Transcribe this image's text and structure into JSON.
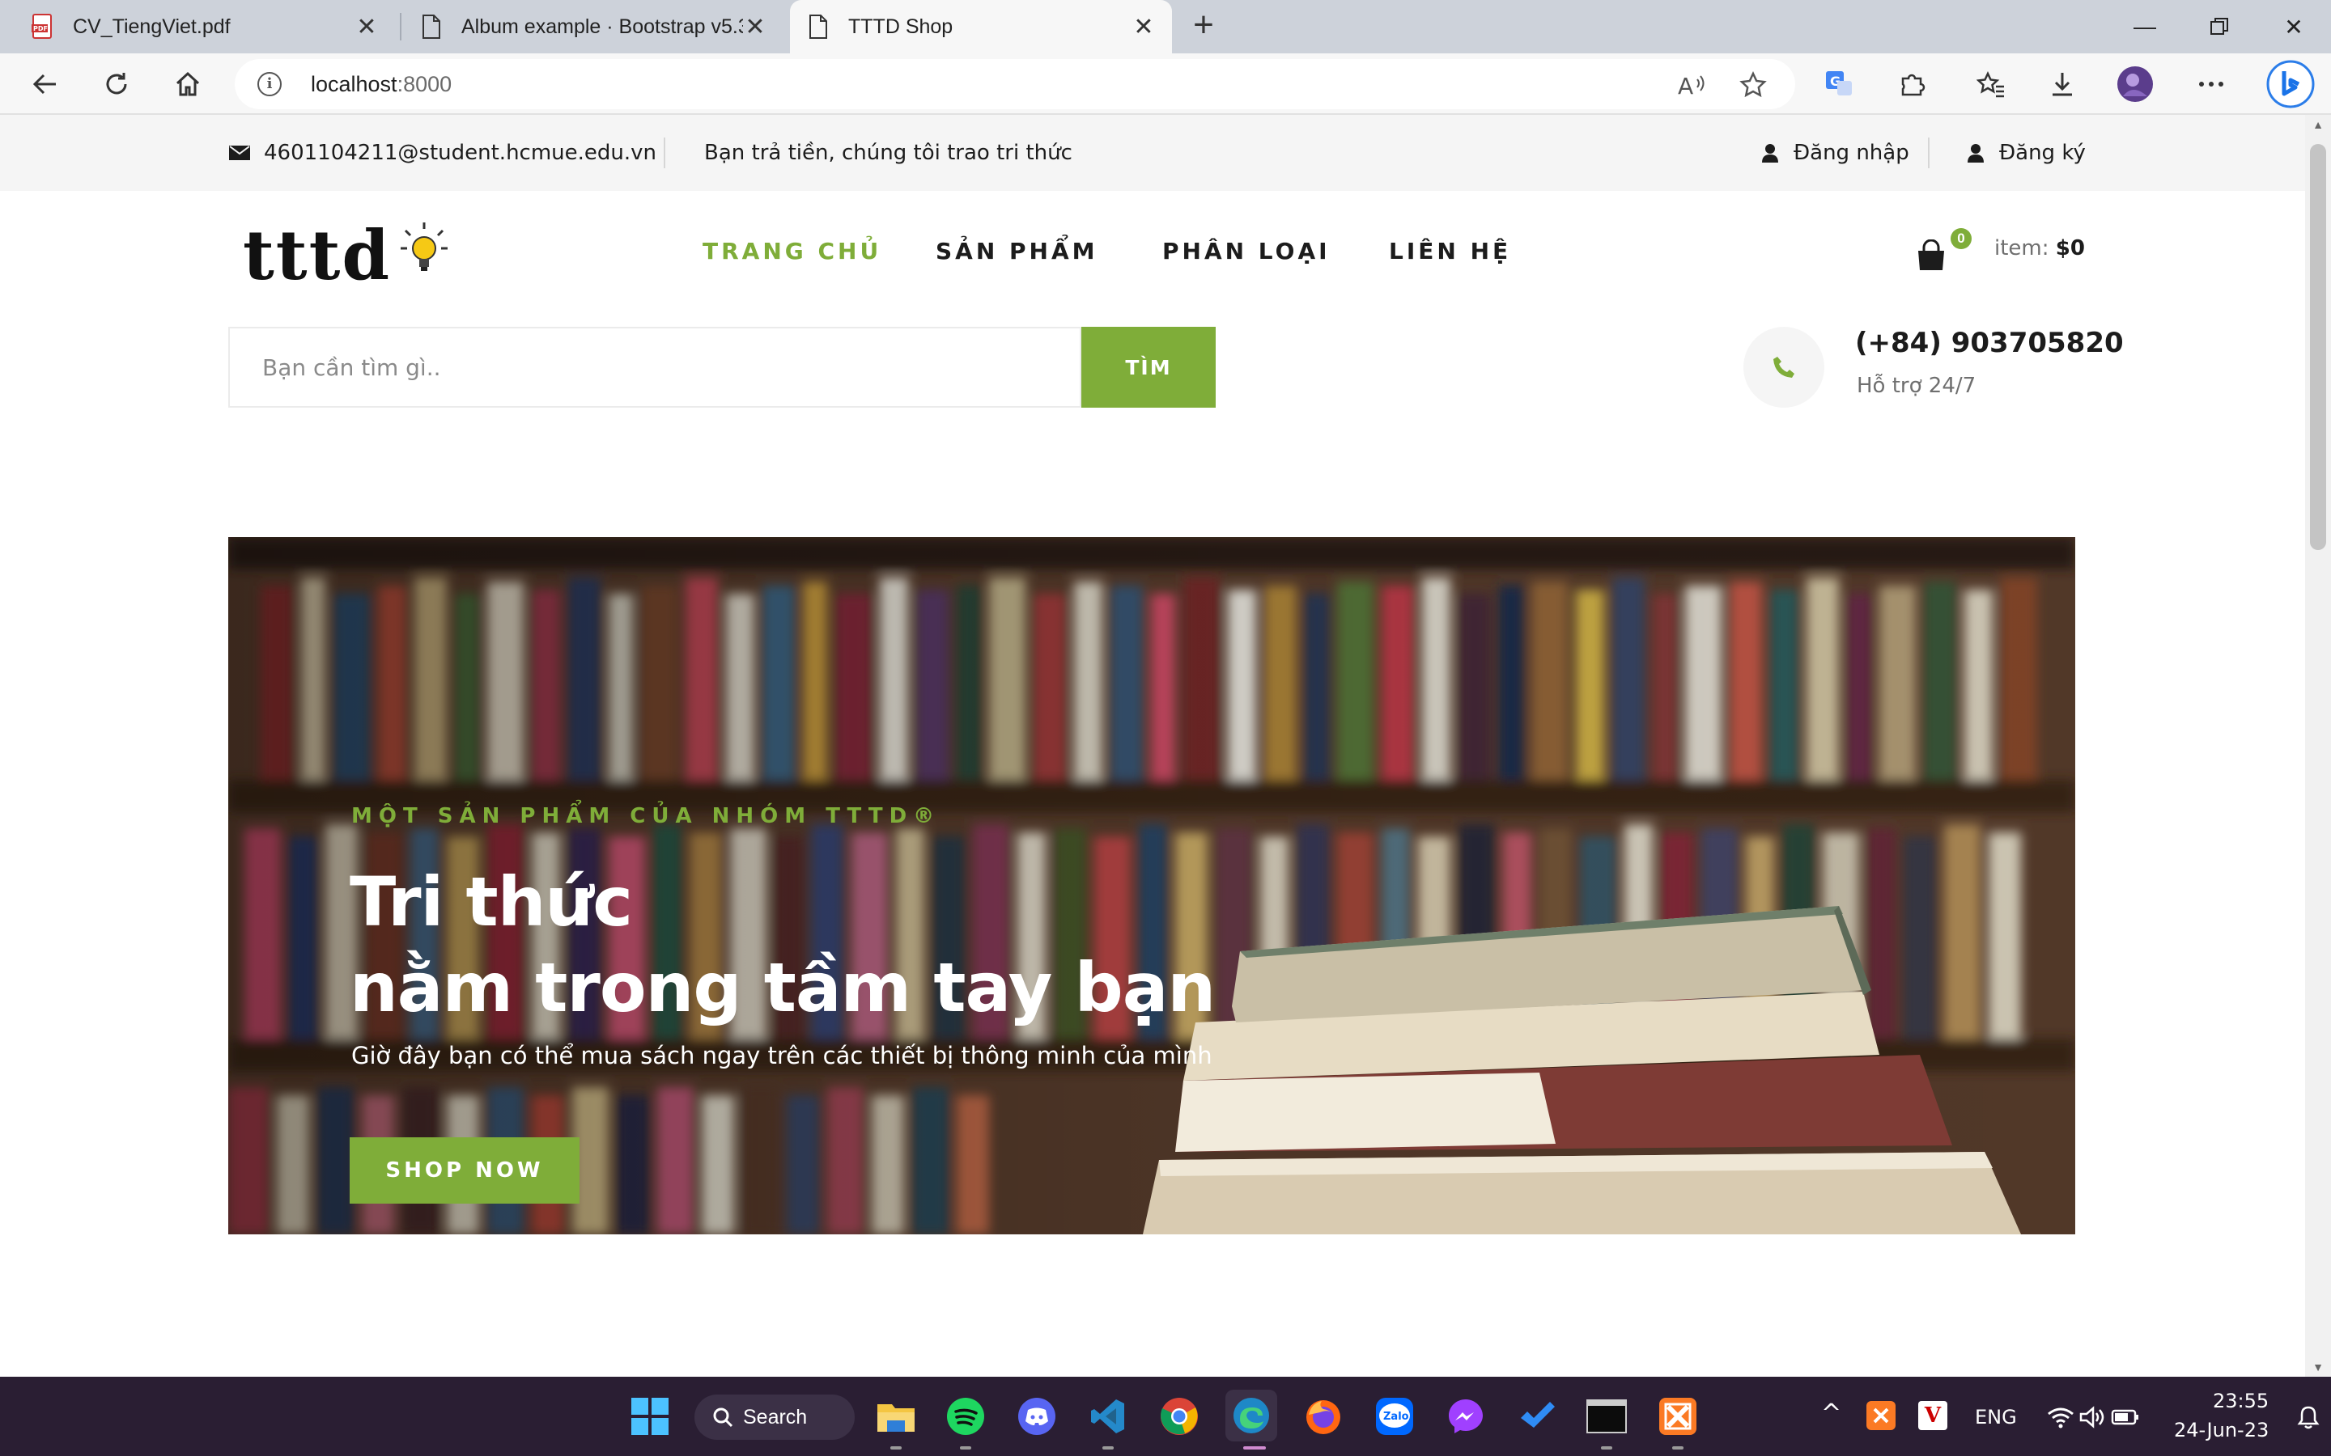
{
  "browser": {
    "tabs": [
      {
        "title": "CV_TiengViet.pdf",
        "icon": "pdf-icon"
      },
      {
        "title": "Album example · Bootstrap v5.3",
        "icon": "page-icon"
      },
      {
        "title": "TTTD Shop",
        "icon": "page-icon",
        "active": true
      }
    ],
    "url_host": "localhost",
    "url_port": ":8000"
  },
  "topbar": {
    "email": "4601104211@student.hcmue.edu.vn",
    "slogan": "Bạn trả tiền, chúng tôi trao tri thức",
    "login": "Đăng nhập",
    "register": "Đăng ký"
  },
  "header": {
    "logo": "tttd",
    "nav": [
      "TRANG CHỦ",
      "SẢN PHẨM",
      "PHÂN LOẠI",
      "LIÊN HỆ"
    ],
    "cart_count": "0",
    "cart_label": "item: ",
    "cart_total": "$0"
  },
  "search": {
    "placeholder": "Bạn cần tìm gì..",
    "button": "TÌM"
  },
  "support": {
    "phone": "(+84) 903705820",
    "text": "Hỗ trợ 24/7"
  },
  "hero": {
    "tagline": "MỘT SẢN PHẨM CỦA NHÓM TTTD®",
    "title_line1": "Tri thức",
    "title_line2": "nằm trong tầm tay bạn",
    "subtitle": "Giờ đây bạn có thể mua sách ngay trên các thiết bị thông minh của mình",
    "button": "SHOP NOW"
  },
  "taskbar": {
    "search": "Search",
    "language": "ENG",
    "time": "23:55",
    "date": "24-Jun-23"
  },
  "colors": {
    "accent": "#7fad39",
    "topbar_bg": "#f5f5f5",
    "taskbar_bg": "#2a1e33"
  }
}
